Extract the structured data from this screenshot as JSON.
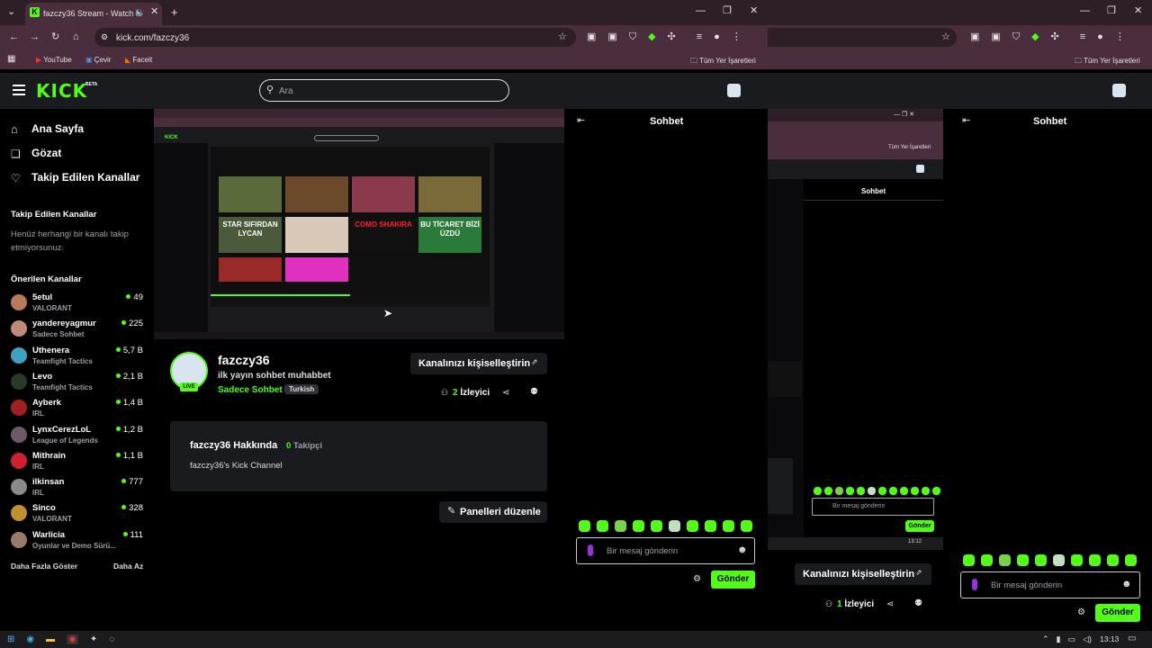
{
  "browser": {
    "tab_title": "fazczy36 Stream - Watch Li",
    "url": "kick.com/fazczy36",
    "bookmarks": [
      "YouTube",
      "Çevir",
      "Faceit"
    ],
    "all_bookmarks": "Tüm Yer İşaretleri",
    "time": "13:13"
  },
  "kick": {
    "search_placeholder": "Ara",
    "beta": "BETA",
    "nav": [
      "Ana Sayfa",
      "Gözat",
      "Takip Edilen Kanallar"
    ],
    "following_title": "Takip Edilen Kanallar",
    "following_empty": "Henüz herhangi bir kanalı takip etmiyorsunuz.",
    "recommended_title": "Önerilen Kanallar",
    "channels": [
      {
        "name": "5etul",
        "category": "VALORANT",
        "viewers": "49",
        "color": "#b87a5a"
      },
      {
        "name": "yandereyagmur",
        "category": "Sadece Sohbet",
        "viewers": "225",
        "color": "#c08a7a"
      },
      {
        "name": "Uthenera",
        "category": "Teamfight Tactics",
        "viewers": "5,7 B",
        "color": "#3fa0c0"
      },
      {
        "name": "Levo",
        "category": "Teamfight Tactics",
        "viewers": "2,1 B",
        "color": "#2a3a2a"
      },
      {
        "name": "Ayberk",
        "category": "IRL",
        "viewers": "1,4 B",
        "color": "#a02020"
      },
      {
        "name": "LynxCerezLoL",
        "category": "League of Legends",
        "viewers": "1,2 B",
        "color": "#6a5a6a"
      },
      {
        "name": "Mithrain",
        "category": "IRL",
        "viewers": "1,1 B",
        "color": "#d02030"
      },
      {
        "name": "ilkinsan",
        "category": "IRL",
        "viewers": "777",
        "color": "#8a8a8a"
      },
      {
        "name": "Sinco",
        "category": "VALORANT",
        "viewers": "328",
        "color": "#c09030"
      },
      {
        "name": "Warlicia",
        "category": "Oyunlar ve Demo Sürü...",
        "viewers": "111",
        "color": "#9a7a6a"
      }
    ],
    "show_more": "Daha Fazla Göster",
    "show_less": "Daha Az",
    "streamer": {
      "name": "fazczy36",
      "title": "ilk yayın sohbet muhabbet",
      "category": "Sadece Sohbet",
      "tag": "Turkish",
      "live": "LIVE",
      "viewers": "2",
      "viewers_label": "İzleyici",
      "customize": "Kanalınızı kişiselleştirin"
    },
    "about": {
      "title": "fazczy36 Hakkında",
      "followers": "0",
      "followers_label": "Takipçi",
      "desc": "fazczy36's Kick Channel"
    },
    "edit_panels": "Panelleri düzenle",
    "chat": {
      "title": "Sohbet",
      "placeholder": "Bir mesaj gönderin",
      "send": "Gönder"
    },
    "right": {
      "customize": "Kanalınızı kişiselleştirin",
      "viewers": "1",
      "viewers_label": "İzleyici",
      "chat_title": "Sohbet",
      "placeholder": "Bir mesaj gönderin",
      "send": "Gönder",
      "small_chat_title": "Sohbet",
      "small_placeholder": "Bir mesaj gönderin",
      "small_send": "Gönder",
      "small_time": "13:12",
      "small_bookmarks": "Tüm Yer İşaretleri"
    }
  },
  "video_thumbs": [
    {
      "text": "",
      "color": "#5a6a3a"
    },
    {
      "text": "",
      "color": "#6a4a2a"
    },
    {
      "text": "",
      "color": "#8a3a4a"
    },
    {
      "text": "",
      "color": "#7a6a3a"
    },
    {
      "text": "STAR SIFIRDAN LYCAN",
      "color": "#4a5a3a"
    },
    {
      "text": "",
      "color": "#d8c8b8"
    },
    {
      "text": "COMO SHAKIRA",
      "color": "#111111"
    },
    {
      "text": "BU TİCARET BİZİ ÜZDÜ",
      "color": "#2a7a3a"
    },
    {
      "text": "",
      "color": "#9a2a2a"
    },
    {
      "text": "",
      "color": "#e030c0"
    }
  ],
  "colors": {
    "accent": "#53fc18",
    "chrome": "#2e1e28",
    "chrome_light": "#4a2e3e",
    "panel": "#191b1f"
  }
}
